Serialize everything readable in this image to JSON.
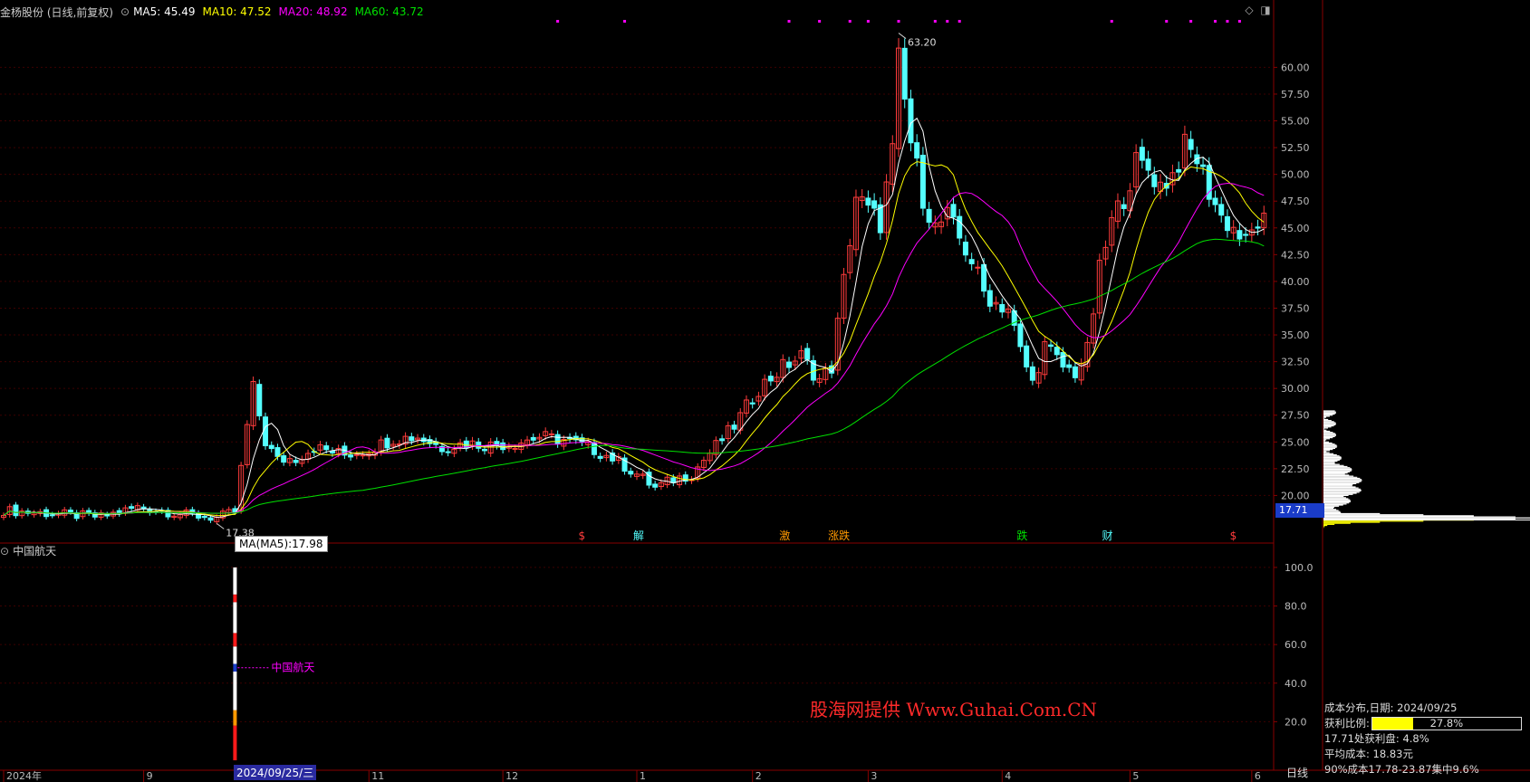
{
  "header": {
    "stock_title": "金杨股份 (日线,前复权)",
    "ma5": "MA5: 45.49",
    "ma10": "MA10: 47.52",
    "ma20": "MA20: 48.92",
    "ma60": "MA60: 43.72"
  },
  "colors": {
    "up": "#ff3c3c",
    "down": "#54ffff",
    "ma5": "#ffffff",
    "ma10": "#ffff00",
    "ma20": "#ff00ff",
    "ma60": "#00e000",
    "grid": "#3a0000",
    "axis": "#880000"
  },
  "sub_panel": {
    "title": "中国航天",
    "line_label": "中国航天"
  },
  "tooltip": "MA(MA5):17.98",
  "cursor_date": "2024/09/25/三",
  "period": "日线",
  "watermark": "股海网提供 Www.Guhai.Com.CN",
  "cost_panel": {
    "date_line": "成本分布,日期: 2024/09/25",
    "ratio_label": "获利比例:",
    "ratio_value": "27.8%",
    "ratio": 0.278,
    "profit_line": "17.71处获利盘: 4.8%",
    "avg_line": "平均成本: 18.83元",
    "range90": "90%成本17.78-23.87集中9.6%"
  },
  "current_price_tag": "17.71",
  "chart_data": [
    {
      "type": "candlestick",
      "name": "金杨股份",
      "y_ticks": [
        20.0,
        22.5,
        25.0,
        27.5,
        30.0,
        32.5,
        35.0,
        37.5,
        40.0,
        42.5,
        45.0,
        47.5,
        50.0,
        52.5,
        55.0,
        57.5,
        60.0
      ],
      "ylim": [
        16.4,
        64.6
      ],
      "x_labels": [
        {
          "label": "2024年",
          "index": 0
        },
        {
          "label": "9",
          "index": 23
        },
        {
          "label": "11",
          "index": 60
        },
        {
          "label": "12",
          "index": 82
        },
        {
          "label": "1",
          "index": 104
        },
        {
          "label": "2",
          "index": 123
        },
        {
          "label": "3",
          "index": 142
        },
        {
          "label": "4",
          "index": 164
        },
        {
          "label": "5",
          "index": 185
        },
        {
          "label": "6",
          "index": 205
        }
      ],
      "annotations": [
        {
          "text": "63.20",
          "index": 147,
          "value": 63.2
        },
        {
          "text": "17.38",
          "index": 35,
          "value": 17.38
        }
      ],
      "events": [
        {
          "text": "$",
          "index": 95,
          "color": "#ff3c3c"
        },
        {
          "text": "解",
          "index": 104,
          "color": "#54ffff"
        },
        {
          "text": "激",
          "index": 128,
          "color": "#ff9900"
        },
        {
          "text": "涨跌",
          "index": 136,
          "color": "#ff9900"
        },
        {
          "text": "跌",
          "index": 167,
          "color": "#00e000"
        },
        {
          "text": "财",
          "index": 181,
          "color": "#54ffff"
        },
        {
          "text": "$",
          "index": 202,
          "color": "#ff3c3c"
        }
      ],
      "top_marks": [
        91,
        102,
        129,
        134,
        139,
        142,
        147,
        153,
        155,
        157,
        182,
        191,
        195,
        199,
        201,
        203
      ],
      "anchors": [
        [
          0,
          18.6
        ],
        [
          8,
          18.3
        ],
        [
          16,
          18.0
        ],
        [
          22,
          18.9
        ],
        [
          30,
          18.2
        ],
        [
          35,
          17.9
        ],
        [
          38,
          18.5
        ],
        [
          40,
          26.5
        ],
        [
          41,
          30.0
        ],
        [
          43,
          25.0
        ],
        [
          45,
          23.3
        ],
        [
          48,
          23.5
        ],
        [
          51,
          24.5
        ],
        [
          56,
          23.8
        ],
        [
          60,
          24.3
        ],
        [
          64,
          25.3
        ],
        [
          68,
          25.5
        ],
        [
          72,
          24.5
        ],
        [
          76,
          24.9
        ],
        [
          80,
          24.7
        ],
        [
          84,
          24.9
        ],
        [
          88,
          25.5
        ],
        [
          92,
          25.2
        ],
        [
          96,
          24.5
        ],
        [
          100,
          23.5
        ],
        [
          104,
          22.0
        ],
        [
          107,
          20.7
        ],
        [
          110,
          21.5
        ],
        [
          113,
          22.0
        ],
        [
          116,
          24.0
        ],
        [
          120,
          26.5
        ],
        [
          124,
          30.0
        ],
        [
          128,
          32.0
        ],
        [
          131,
          33.0
        ],
        [
          134,
          30.8
        ],
        [
          136,
          32.0
        ],
        [
          138,
          40.0
        ],
        [
          140,
          48.0
        ],
        [
          142,
          46.5
        ],
        [
          144,
          45.5
        ],
        [
          146,
          52.0
        ],
        [
          147,
          60.5
        ],
        [
          149,
          53.0
        ],
        [
          151,
          48.0
        ],
        [
          153,
          45.0
        ],
        [
          155,
          46.0
        ],
        [
          157,
          44.0
        ],
        [
          159,
          42.0
        ],
        [
          161,
          39.0
        ],
        [
          163,
          38.0
        ],
        [
          165,
          37.5
        ],
        [
          167,
          33.5
        ],
        [
          169,
          30.5
        ],
        [
          171,
          34.0
        ],
        [
          174,
          32.0
        ],
        [
          176,
          31.5
        ],
        [
          178,
          33.5
        ],
        [
          180,
          41.0
        ],
        [
          182,
          45.5
        ],
        [
          184,
          48.0
        ],
        [
          186,
          51.0
        ],
        [
          188,
          50.5
        ],
        [
          190,
          49.0
        ],
        [
          192,
          50.0
        ],
        [
          194,
          52.5
        ],
        [
          196,
          51.5
        ],
        [
          198,
          48.5
        ],
        [
          200,
          46.0
        ],
        [
          202,
          45.0
        ],
        [
          204,
          43.5
        ],
        [
          206,
          45.5
        ]
      ],
      "ma_values": {
        "MA5": 45.49,
        "MA10": 47.52,
        "MA20": 48.92,
        "MA60": 43.72
      }
    },
    {
      "type": "bar",
      "name": "中国航天",
      "y_ticks": [
        20.0,
        40.0,
        60.0,
        80.0,
        100.0
      ],
      "ylim": [
        0,
        107
      ],
      "bar_index": 38,
      "bar_range": [
        0,
        100
      ],
      "line_value": 48.0,
      "segments": [
        {
          "from": 0,
          "to": 18,
          "color": "#ff1a1a"
        },
        {
          "from": 18,
          "to": 26,
          "color": "#ff9900"
        },
        {
          "from": 26,
          "to": 46,
          "color": "#ffffff"
        },
        {
          "from": 46,
          "to": 50,
          "color": "#1a3cc8"
        },
        {
          "from": 50,
          "to": 59,
          "color": "#ffffff"
        },
        {
          "from": 59,
          "to": 66,
          "color": "#ff1a1a"
        },
        {
          "from": 66,
          "to": 82,
          "color": "#ffffff"
        },
        {
          "from": 82,
          "to": 86,
          "color": "#ff1a1a"
        },
        {
          "from": 86,
          "to": 100,
          "color": "#ffffff"
        }
      ]
    }
  ]
}
